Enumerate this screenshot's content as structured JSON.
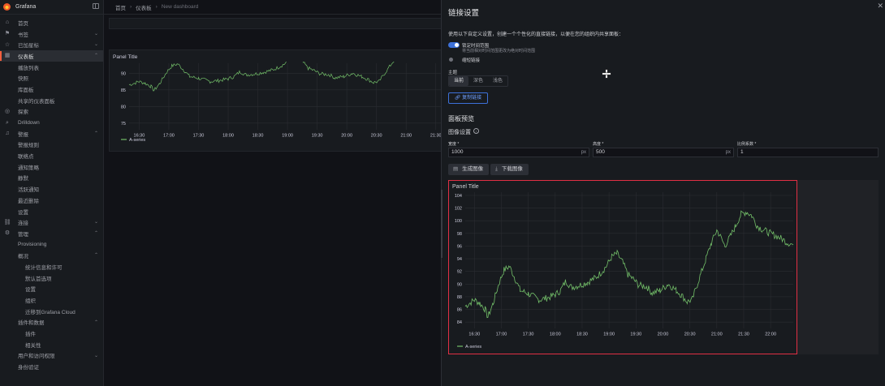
{
  "app": {
    "name": "Grafana"
  },
  "breadcrumb": [
    "首页",
    "仪表板",
    "New dashboard"
  ],
  "sidebar": {
    "items": [
      {
        "label": "首页",
        "icon": "home-icon",
        "level": 0
      },
      {
        "label": "书签",
        "icon": "bookmark-icon",
        "level": 0,
        "expandable": true
      },
      {
        "label": "已加星标",
        "icon": "star-icon",
        "level": 0,
        "expandable": true
      },
      {
        "label": "仪表板",
        "icon": "dashboards-icon",
        "level": 0,
        "expandable": true,
        "expanded": true,
        "selected": true
      },
      {
        "label": "播放列表",
        "level": 1
      },
      {
        "label": "快照",
        "level": 1
      },
      {
        "label": "库面板",
        "level": 1
      },
      {
        "label": "共享的仪表面板",
        "level": 1
      },
      {
        "label": "探索",
        "icon": "explore-icon",
        "level": 0
      },
      {
        "label": "Drilldown",
        "icon": "drilldown-icon",
        "level": 0
      },
      {
        "label": "警报",
        "icon": "bell-icon",
        "level": 0,
        "expandable": true,
        "expanded": true
      },
      {
        "label": "警报规则",
        "level": 1
      },
      {
        "label": "联络点",
        "level": 1
      },
      {
        "label": "通知策略",
        "level": 1
      },
      {
        "label": "静默",
        "level": 1
      },
      {
        "label": "活跃通知",
        "level": 1
      },
      {
        "label": "最近删除",
        "level": 1
      },
      {
        "label": "设置",
        "level": 1
      },
      {
        "label": "连接",
        "icon": "connections-icon",
        "level": 0,
        "expandable": true
      },
      {
        "label": "管理",
        "icon": "gear-icon",
        "level": 0,
        "expandable": true,
        "expanded": true
      },
      {
        "label": "Provisioning",
        "level": 1
      },
      {
        "label": "概况",
        "level": 1,
        "expandable": true,
        "expanded": true
      },
      {
        "label": "统计信息和许可",
        "level": 2
      },
      {
        "label": "默认首选项",
        "level": 2
      },
      {
        "label": "设置",
        "level": 2
      },
      {
        "label": "组织",
        "level": 2
      },
      {
        "label": "迁移到Grafana Cloud",
        "level": 2
      },
      {
        "label": "插件和数据",
        "level": 1,
        "expandable": true,
        "expanded": true
      },
      {
        "label": "插件",
        "level": 2
      },
      {
        "label": "相关性",
        "level": 2
      },
      {
        "label": "用户和访问权限",
        "level": 1,
        "expandable": true
      },
      {
        "label": "身份验证",
        "level": 1
      }
    ]
  },
  "background_panel": {
    "title": "Panel Title",
    "legend": "A-series"
  },
  "drawer": {
    "title": "链接设置",
    "description": "使用以下自定义设置，创建一个个性化的直接链接，以便在您的组织内共享面板：",
    "lock_time_label": "锁定时间范围",
    "lock_time_desc": "将当前相对时间范围更改为绝对时间范围",
    "lock_time_enabled": true,
    "short_link_label": "缩短链接",
    "theme_label": "主题",
    "theme_options": [
      "当前",
      "深色",
      "浅色"
    ],
    "theme_selected": "当前",
    "copy_link": "复制链接",
    "preview_section": "面板预览",
    "image_settings": "图像设置",
    "width_label": "宽度 *",
    "width_value": "1000",
    "width_unit": "px",
    "height_label": "高度 *",
    "height_value": "500",
    "height_unit": "px",
    "scale_label": "比例系数 *",
    "scale_value": "1",
    "generate_btn": "生成图像",
    "download_btn": "下载图像"
  },
  "chart_data": [
    {
      "type": "line",
      "title": "Panel Title",
      "series": [
        {
          "name": "A-series",
          "color": "#73bf69"
        }
      ],
      "x_ticks": [
        "16:30",
        "17:00",
        "17:30",
        "18:00",
        "18:30",
        "19:00",
        "19:30",
        "20:00",
        "20:30",
        "21:00",
        "21:30",
        "22:00"
      ],
      "y_ticks": [
        84,
        86,
        88,
        90,
        92,
        94,
        96,
        98,
        100,
        102,
        104
      ],
      "ylim": [
        83,
        104.5
      ],
      "xlim_hours": [
        16.33,
        22.42
      ],
      "keypoints": [
        [
          16.33,
          86.5
        ],
        [
          16.5,
          87.5
        ],
        [
          16.6,
          87
        ],
        [
          16.7,
          86
        ],
        [
          16.75,
          84.8
        ],
        [
          16.85,
          87
        ],
        [
          16.95,
          90
        ],
        [
          17.05,
          92.2
        ],
        [
          17.15,
          92.8
        ],
        [
          17.25,
          91
        ],
        [
          17.35,
          89
        ],
        [
          17.5,
          88.5
        ],
        [
          17.7,
          87.5
        ],
        [
          17.85,
          87.8
        ],
        [
          18.0,
          88.3
        ],
        [
          18.1,
          89
        ],
        [
          18.2,
          90.5
        ],
        [
          18.3,
          89.5
        ],
        [
          18.45,
          89.8
        ],
        [
          18.6,
          90.3
        ],
        [
          18.75,
          91
        ],
        [
          18.85,
          91.8
        ],
        [
          18.95,
          92.8
        ],
        [
          19.05,
          94.3
        ],
        [
          19.15,
          94.8
        ],
        [
          19.25,
          93.5
        ],
        [
          19.35,
          91.5
        ],
        [
          19.45,
          90.8
        ],
        [
          19.55,
          89.8
        ],
        [
          19.7,
          89.6
        ],
        [
          19.8,
          88.6
        ],
        [
          19.95,
          89
        ],
        [
          20.1,
          90
        ],
        [
          20.25,
          89
        ],
        [
          20.35,
          88.2
        ],
        [
          20.45,
          87.2
        ],
        [
          20.55,
          87.6
        ],
        [
          20.6,
          89
        ],
        [
          20.7,
          91.5
        ],
        [
          20.8,
          94
        ],
        [
          20.9,
          96.5
        ],
        [
          21.0,
          98.5
        ],
        [
          21.05,
          97.8
        ],
        [
          21.15,
          96
        ],
        [
          21.25,
          97.5
        ],
        [
          21.35,
          99.2
        ],
        [
          21.45,
          101
        ],
        [
          21.55,
          101.4
        ],
        [
          21.65,
          100.8
        ],
        [
          21.75,
          99.2
        ],
        [
          21.85,
          98.6
        ],
        [
          22.0,
          98
        ],
        [
          22.1,
          97.6
        ],
        [
          22.2,
          97.2
        ],
        [
          22.3,
          96.6
        ],
        [
          22.42,
          96.2
        ]
      ]
    }
  ]
}
